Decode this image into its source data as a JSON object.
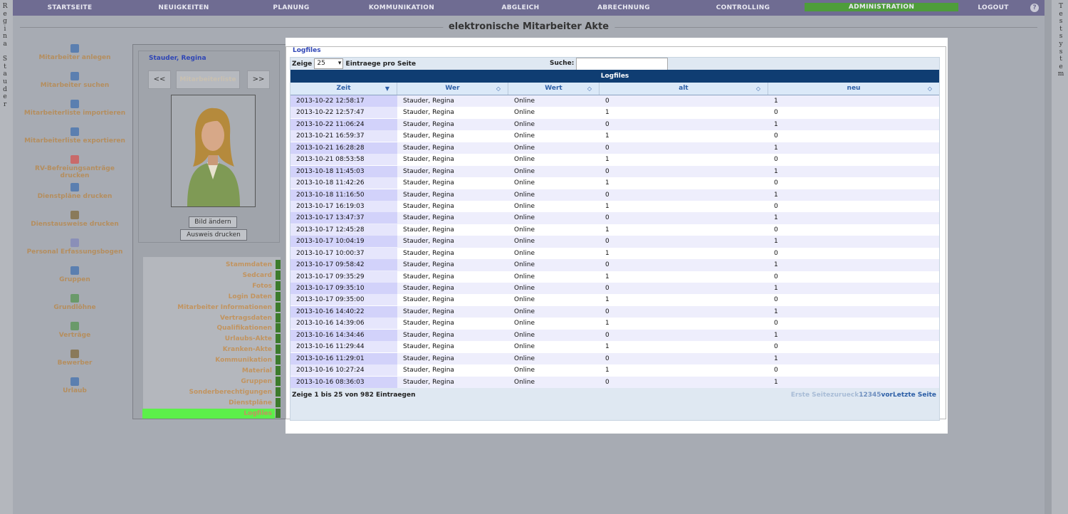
{
  "topnav": {
    "items": [
      {
        "label": "STARTSEITE"
      },
      {
        "label": "NEUIGKEITEN"
      },
      {
        "label": "PLANUNG"
      },
      {
        "label": "KOMMUNIKATION"
      },
      {
        "label": "ABGLEICH"
      },
      {
        "label": "ABRECHNUNG"
      },
      {
        "label": "CONTROLLING"
      },
      {
        "label": "ADMINISTRATION",
        "active": true
      },
      {
        "label": "LOGOUT"
      }
    ],
    "help_icon": "?"
  },
  "side_left_text": [
    "R",
    "e",
    "g",
    "i",
    "n",
    "a",
    " ",
    "S",
    "t",
    "a",
    "u",
    "d",
    "e",
    "r"
  ],
  "side_right_text": [
    "T",
    "e",
    "s",
    "t",
    "s",
    "y",
    "s",
    "t",
    "e",
    "m"
  ],
  "page_title": "elektronische Mitarbeiter Akte",
  "left_menu": [
    {
      "label": "Mitarbeiter anlegen",
      "icon": "user-add-icon",
      "color": "#5b7fb0"
    },
    {
      "label": "Mitarbeiter suchen",
      "icon": "user-search-icon",
      "color": "#5b7fb0"
    },
    {
      "label": "Mitarbeiterliste importieren",
      "icon": "users-import-icon",
      "color": "#5b7fb0"
    },
    {
      "label": "Mitarbeiterliste exportieren",
      "icon": "users-export-icon",
      "color": "#5b7fb0"
    },
    {
      "label": "RV-Befreiungsanträge",
      "label2": "drucken",
      "icon": "pdf-icon",
      "color": "#c96a6a"
    },
    {
      "label": "Dienstpläne drucken",
      "icon": "user-print-icon",
      "color": "#5b7fb0"
    },
    {
      "label": "Dienstausweise drucken",
      "icon": "edit-icon",
      "color": "#8a7a5a"
    },
    {
      "label": "Personal Erfassungsbogen",
      "icon": "document-icon",
      "color": "#8a8fb8"
    },
    {
      "label": "Gruppen",
      "icon": "group-icon",
      "color": "#5b7fb0"
    },
    {
      "label": "Grundlöhne",
      "icon": "wage-icon",
      "color": "#6a9a6a"
    },
    {
      "label": "Verträge",
      "icon": "contract-icon",
      "color": "#6a9a6a"
    },
    {
      "label": "Bewerber",
      "icon": "applicant-icon",
      "color": "#8a7a5a"
    },
    {
      "label": "Urlaub",
      "icon": "vacation-icon",
      "color": "#5b7fb0"
    }
  ],
  "profile": {
    "name": "Stauder, Regina",
    "prev_label": "<<",
    "list_label": "Mitarbeiterliste",
    "next_label": ">>",
    "change_picture_label": "Bild ändern",
    "print_id_label": "Ausweis drucken"
  },
  "tabs": [
    {
      "label": "Stammdaten"
    },
    {
      "label": "Sedcard"
    },
    {
      "label": "Fotos"
    },
    {
      "label": "Login Daten"
    },
    {
      "label": "Mitarbeiter Informationen"
    },
    {
      "label": "Vertragsdaten"
    },
    {
      "label": "Qualifikationen"
    },
    {
      "label": "Urlaubs-Akte"
    },
    {
      "label": "Kranken-Akte"
    },
    {
      "label": "Kommunikation"
    },
    {
      "label": "Material"
    },
    {
      "label": "Gruppen"
    },
    {
      "label": "Sonderberechtigungen"
    },
    {
      "label": "Dienstpläne"
    },
    {
      "label": "Logfiles",
      "active": true
    }
  ],
  "logfiles": {
    "legend": "Logfiles",
    "show_label": "Zeige",
    "page_size": "25",
    "per_page_label": "Eintraege pro Seite",
    "search_label": "Suche:",
    "search_value": "",
    "table_title": "Logfiles",
    "columns": [
      "Zeit",
      "Wer",
      "Wert",
      "alt",
      "neu"
    ],
    "rows": [
      [
        "2013-10-22 12:58:17",
        "Stauder, Regina",
        "Online",
        "0",
        "1"
      ],
      [
        "2013-10-22 12:57:47",
        "Stauder, Regina",
        "Online",
        "1",
        "0"
      ],
      [
        "2013-10-22 11:06:24",
        "Stauder, Regina",
        "Online",
        "0",
        "1"
      ],
      [
        "2013-10-21 16:59:37",
        "Stauder, Regina",
        "Online",
        "1",
        "0"
      ],
      [
        "2013-10-21 16:28:28",
        "Stauder, Regina",
        "Online",
        "0",
        "1"
      ],
      [
        "2013-10-21 08:53:58",
        "Stauder, Regina",
        "Online",
        "1",
        "0"
      ],
      [
        "2013-10-18 11:45:03",
        "Stauder, Regina",
        "Online",
        "0",
        "1"
      ],
      [
        "2013-10-18 11:42:26",
        "Stauder, Regina",
        "Online",
        "1",
        "0"
      ],
      [
        "2013-10-18 11:16:50",
        "Stauder, Regina",
        "Online",
        "0",
        "1"
      ],
      [
        "2013-10-17 16:19:03",
        "Stauder, Regina",
        "Online",
        "1",
        "0"
      ],
      [
        "2013-10-17 13:47:37",
        "Stauder, Regina",
        "Online",
        "0",
        "1"
      ],
      [
        "2013-10-17 12:45:28",
        "Stauder, Regina",
        "Online",
        "1",
        "0"
      ],
      [
        "2013-10-17 10:04:19",
        "Stauder, Regina",
        "Online",
        "0",
        "1"
      ],
      [
        "2013-10-17 10:00:37",
        "Stauder, Regina",
        "Online",
        "1",
        "0"
      ],
      [
        "2013-10-17 09:58:42",
        "Stauder, Regina",
        "Online",
        "0",
        "1"
      ],
      [
        "2013-10-17 09:35:29",
        "Stauder, Regina",
        "Online",
        "1",
        "0"
      ],
      [
        "2013-10-17 09:35:10",
        "Stauder, Regina",
        "Online",
        "0",
        "1"
      ],
      [
        "2013-10-17 09:35:00",
        "Stauder, Regina",
        "Online",
        "1",
        "0"
      ],
      [
        "2013-10-16 14:40:22",
        "Stauder, Regina",
        "Online",
        "0",
        "1"
      ],
      [
        "2013-10-16 14:39:06",
        "Stauder, Regina",
        "Online",
        "1",
        "0"
      ],
      [
        "2013-10-16 14:34:46",
        "Stauder, Regina",
        "Online",
        "0",
        "1"
      ],
      [
        "2013-10-16 11:29:44",
        "Stauder, Regina",
        "Online",
        "1",
        "0"
      ],
      [
        "2013-10-16 11:29:01",
        "Stauder, Regina",
        "Online",
        "0",
        "1"
      ],
      [
        "2013-10-16 10:27:24",
        "Stauder, Regina",
        "Online",
        "1",
        "0"
      ],
      [
        "2013-10-16 08:36:03",
        "Stauder, Regina",
        "Online",
        "0",
        "1"
      ]
    ],
    "info": "Zeige 1 bis 25 von 982 Eintraegen",
    "pager": {
      "first": "Erste Seite",
      "prev": "zurueck",
      "pages": "12345",
      "next": "vor",
      "last": "Letzte Seite"
    }
  }
}
